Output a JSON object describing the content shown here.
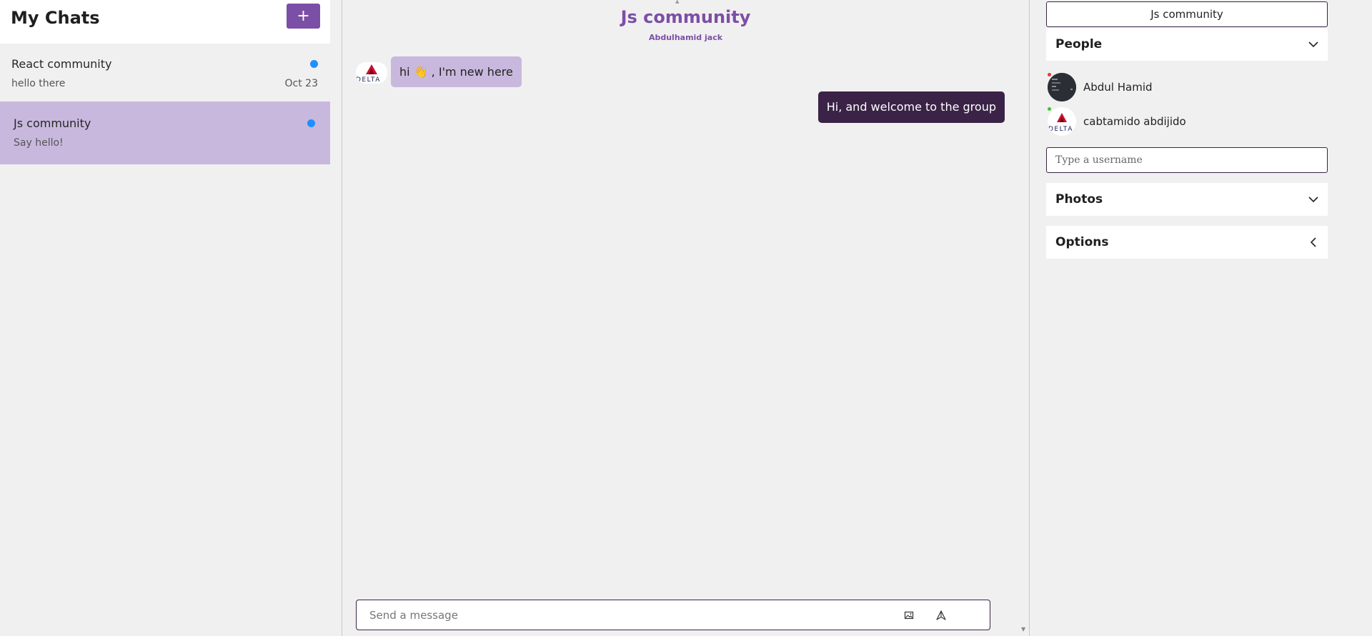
{
  "sidebar": {
    "title": "My Chats",
    "new_chat_label": "+",
    "chats": [
      {
        "name": "React community",
        "preview": "hello there",
        "date": "Oct 23",
        "unread": true,
        "active": false
      },
      {
        "name": "Js community",
        "preview": "Say hello!",
        "date": "",
        "unread": true,
        "active": true
      }
    ]
  },
  "chat": {
    "title": "Js community",
    "subtitle": "Abdulhamid jack",
    "avatar_logo_text": "DELTA",
    "messages": [
      {
        "direction": "incoming",
        "text": "hi 👋 , I'm new here"
      },
      {
        "direction": "outgoing",
        "text": "Hi, and welcome to the group"
      }
    ],
    "composer": {
      "placeholder": "Send a message",
      "attach_icon": "image-icon",
      "send_icon": "send-icon"
    }
  },
  "settings": {
    "room_name": "Js community",
    "sections": {
      "people": {
        "title": "People",
        "state": "expanded"
      },
      "photos": {
        "title": "Photos",
        "state": "collapsed"
      },
      "options": {
        "title": "Options",
        "state": "collapsed"
      }
    },
    "people": [
      {
        "name": "Abdul Hamid",
        "status": "offline",
        "status_color": "#e03b3b"
      },
      {
        "name": "cabtamido abdijido",
        "status": "online",
        "status_color": "#3bc43b"
      }
    ],
    "username_placeholder": "Type a username"
  },
  "colors": {
    "accent": "#7c4fa6",
    "active_chat_bg": "#c9b8de",
    "outgoing_bubble": "#3b2347",
    "unread_dot": "#1e90ff"
  }
}
